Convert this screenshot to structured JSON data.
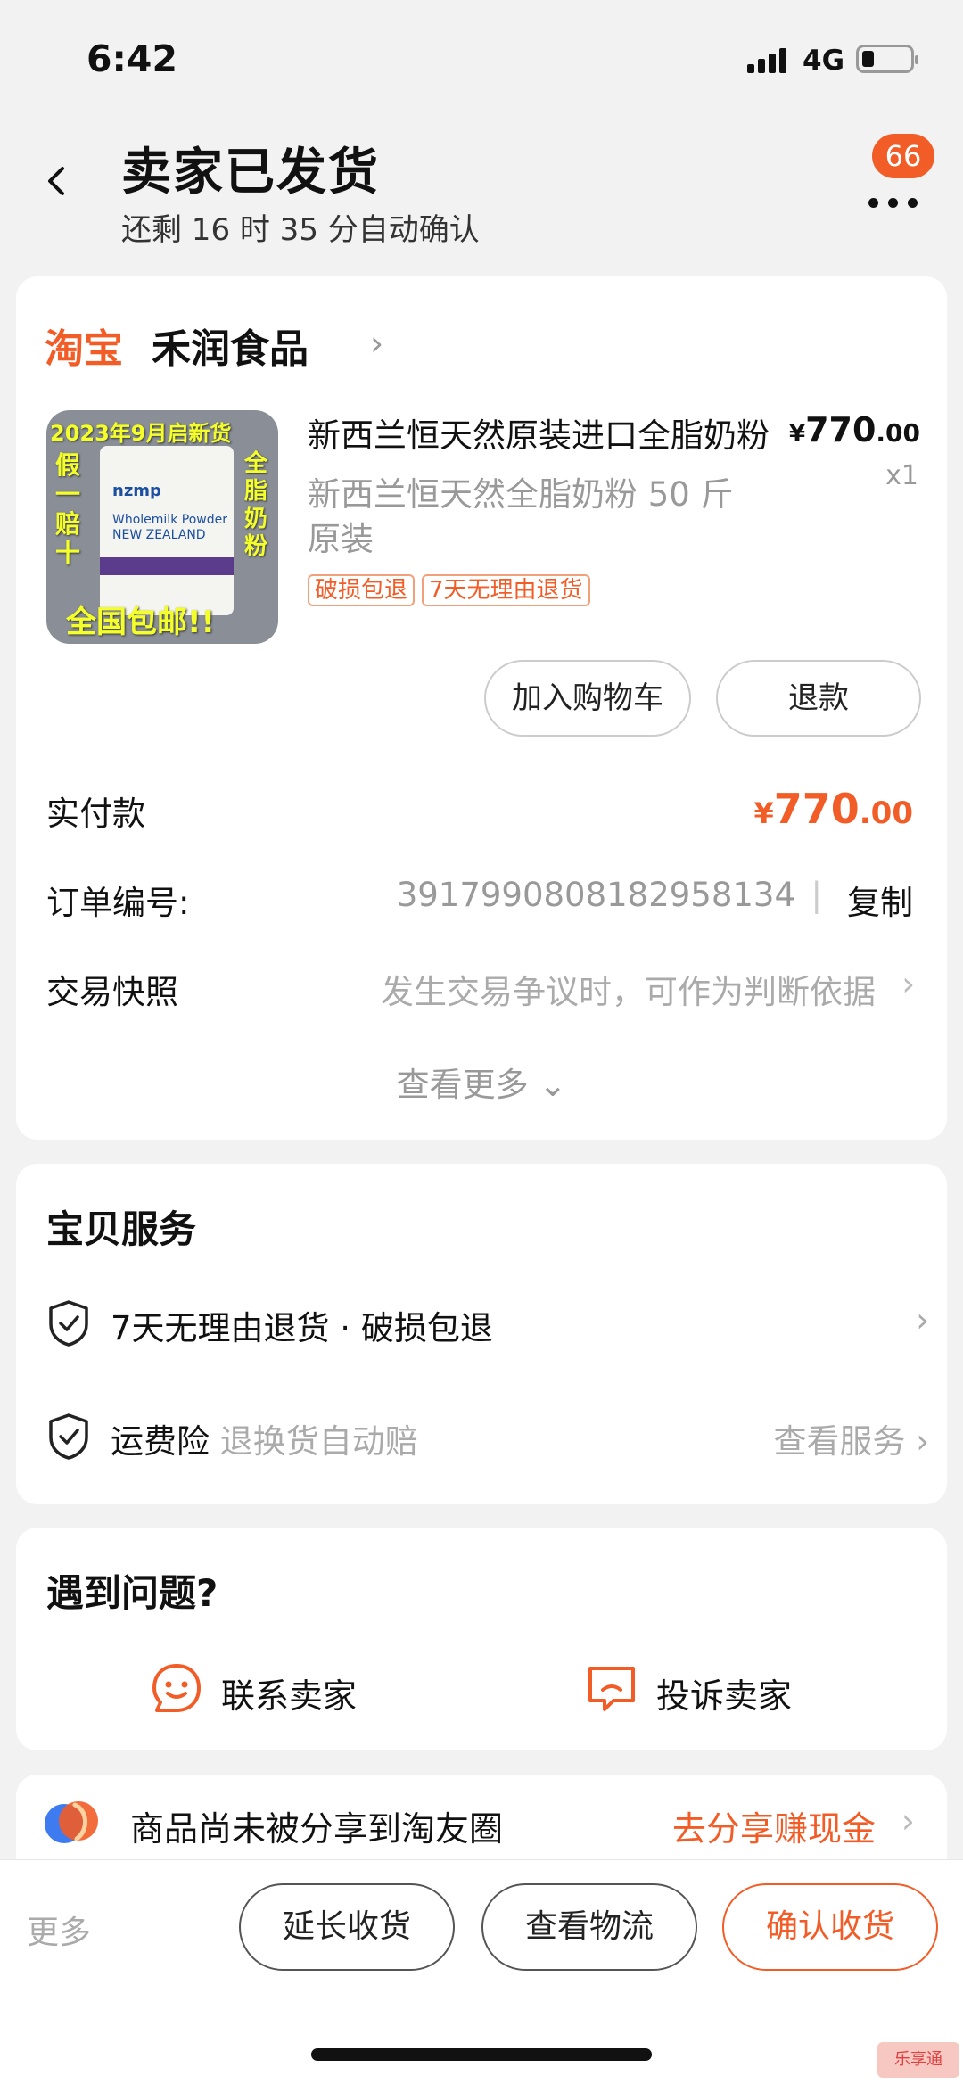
{
  "status": {
    "time": "6:42",
    "network": "4G"
  },
  "header": {
    "title": "卖家已发货",
    "subtitle": "还剩 16 时 35 分自动确认",
    "badge_count": "66"
  },
  "order": {
    "platform": "淘宝",
    "shop_name": "禾润食品",
    "product": {
      "name": "新西兰恒天然原装进口全脂奶粉",
      "spec": "新西兰恒天然全脂奶粉 50 斤原装",
      "price_currency": "¥",
      "price_int": "770",
      "price_dec": ".00",
      "quantity": "x1",
      "tags": [
        "破损包退",
        "7天无理由退货"
      ],
      "image_text": {
        "top": "2023年9月启新货",
        "left": "假一赔十",
        "right": "全脂奶粉",
        "bottom": "全国包邮!!",
        "brand": "nzmp",
        "product": "Wholemilk Powder NEW ZEALAND"
      }
    },
    "buttons": {
      "add_cart": "加入购物车",
      "refund": "退款"
    },
    "paid_label": "实付款",
    "paid_currency": "¥",
    "paid_int": "770",
    "paid_dec": ".00",
    "order_no_label": "订单编号:",
    "order_no": "3917990808182958134",
    "copy_label": "复制",
    "snapshot_label": "交易快照",
    "snapshot_hint": "发生交易争议时，可作为判断依据",
    "view_more": "查看更多"
  },
  "services": {
    "title": "宝贝服务",
    "return_policy": "7天无理由退货 · 破损包退",
    "shipping_insurance": "运费险",
    "shipping_insurance_desc": "退换货自动赔",
    "view_service": "查看服务"
  },
  "help": {
    "title": "遇到问题?",
    "contact_seller": "联系卖家",
    "complain_seller": "投诉卖家"
  },
  "share": {
    "text": "商品尚未被分享到淘友圈",
    "action": "去分享赚现金"
  },
  "bottom_bar": {
    "more": "更多",
    "extend": "延长收货",
    "logistics": "查看物流",
    "confirm": "确认收货"
  },
  "watermark": "乐享通",
  "colors": {
    "accent": "#f25c27",
    "muted": "#999999",
    "background": "#f2f2f2"
  }
}
